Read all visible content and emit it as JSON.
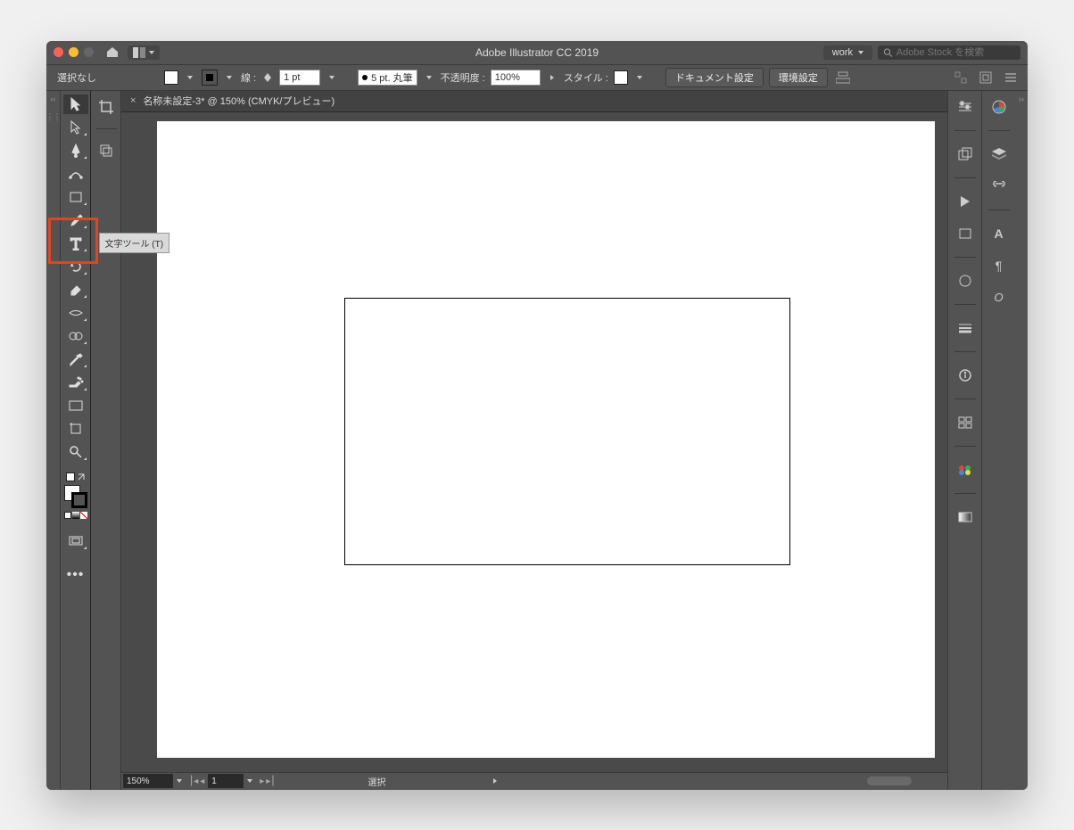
{
  "titlebar": {
    "app_title": "Adobe Illustrator CC 2019",
    "workspace": "work",
    "search_placeholder": "Adobe Stock を検索"
  },
  "controlbar": {
    "selection": "選択なし",
    "stroke_label": "線 :",
    "stroke_weight": "1 pt",
    "brush": "5 pt. 丸筆",
    "opacity_label": "不透明度 :",
    "opacity": "100%",
    "style_label": "スタイル :",
    "doc_setup": "ドキュメント設定",
    "prefs": "環境設定"
  },
  "tab": {
    "label": "名称未設定-3* @ 150% (CMYK/プレビュー)"
  },
  "tooltip": {
    "type_tool": "文字ツール (T)"
  },
  "statusbar": {
    "zoom": "150%",
    "artboard_num": "1",
    "mode": "選択"
  }
}
